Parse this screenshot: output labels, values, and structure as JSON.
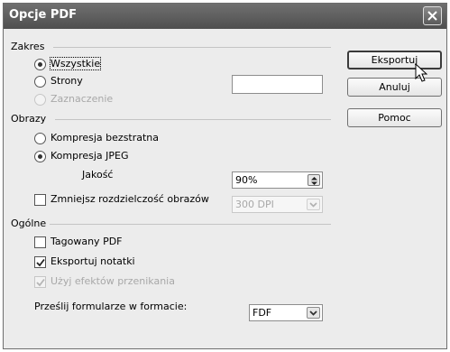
{
  "window": {
    "title": "Opcje PDF"
  },
  "buttons": {
    "export": "Eksportuj",
    "cancel": "Anuluj",
    "help": "Pomoc"
  },
  "sections": {
    "range": {
      "title": "Zakres",
      "all": "Wszystkie",
      "pages": "Strony",
      "pages_value": "",
      "selection": "Zaznaczenie"
    },
    "images": {
      "title": "Obrazy",
      "lossless": "Kompresja bezstratna",
      "jpeg": "Kompresja JPEG",
      "quality_label": "Jakość",
      "quality_value": "90%",
      "reduce_resolution": "Zmniejsz rozdzielczość obrazów",
      "resolution_value": "300 DPI"
    },
    "general": {
      "title": "Ogólne",
      "tagged_pdf": "Tagowany PDF",
      "export_notes": "Eksportuj notatki",
      "transition_effects": "Użyj efektów przenikania",
      "submit_format_label": "Prześlij formularze w formacie:",
      "submit_format_value": "FDF"
    }
  },
  "state": {
    "range_selected": "all",
    "image_compression": "jpeg",
    "reduce_resolution": false,
    "tagged_pdf": false,
    "export_notes": true,
    "transition_effects": true
  }
}
